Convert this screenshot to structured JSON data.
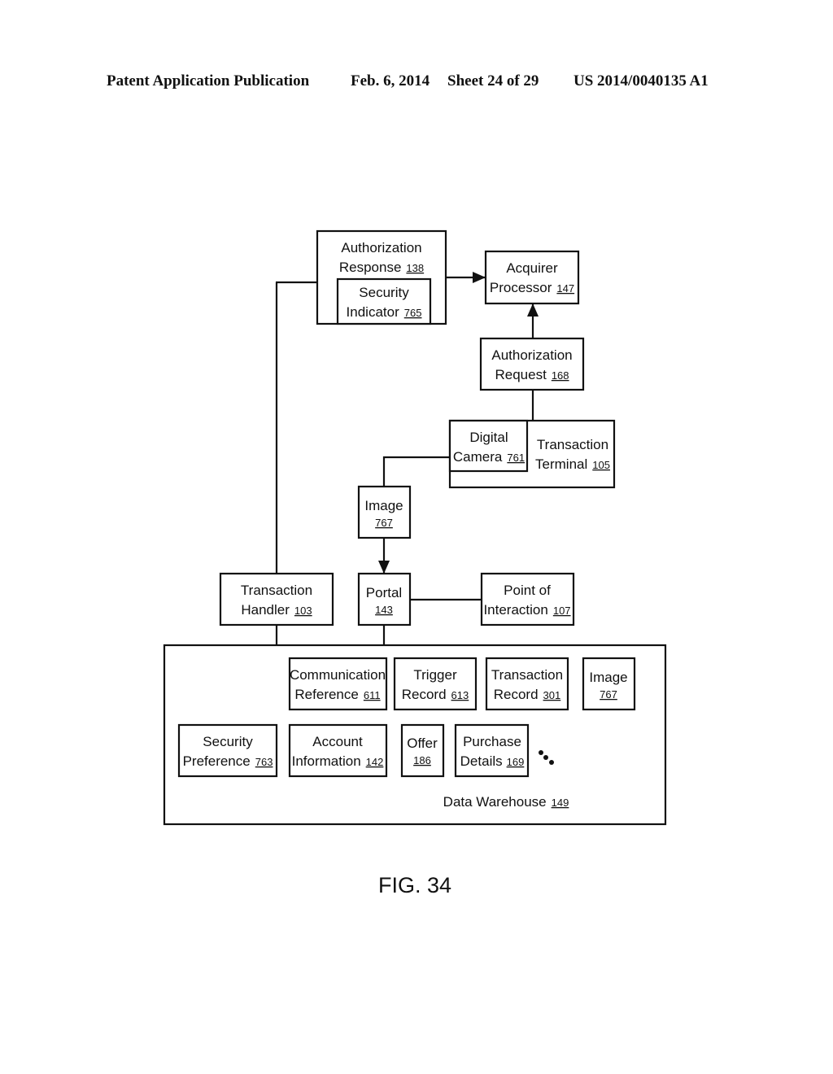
{
  "header": {
    "publication": "Patent Application Publication",
    "date": "Feb. 6, 2014",
    "sheet": "Sheet 24 of 29",
    "number": "US 2014/0040135 A1"
  },
  "figure_label": "FIG. 34",
  "nodes": {
    "auth_response": {
      "l1": "Authorization",
      "l2": "Response",
      "ref": "138"
    },
    "security_indicator": {
      "l1": "Security",
      "l2": "Indicator",
      "ref": "765"
    },
    "acquirer_processor": {
      "l1": "Acquirer",
      "l2": "Processor",
      "ref": "147"
    },
    "auth_request": {
      "l1": "Authorization",
      "l2": "Request",
      "ref": "168"
    },
    "digital_camera": {
      "l1": "Digital",
      "l2": "Camera",
      "ref": "761"
    },
    "transaction_terminal": {
      "l1": "Transaction",
      "l2": "Terminal",
      "ref": "105"
    },
    "image_top": {
      "l1": "Image",
      "ref": "767"
    },
    "transaction_handler": {
      "l1": "Transaction",
      "l2": "Handler",
      "ref": "103"
    },
    "portal": {
      "l1": "Portal",
      "ref": "143"
    },
    "point_of_interaction": {
      "l1": "Point of",
      "l2": "Interaction",
      "ref": "107"
    },
    "communication_reference": {
      "l1": "Communication",
      "l2": "Reference",
      "ref": "611"
    },
    "trigger_record": {
      "l1": "Trigger",
      "l2": "Record",
      "ref": "613"
    },
    "transaction_record": {
      "l1": "Transaction",
      "l2": "Record",
      "ref": "301"
    },
    "image_warehouse": {
      "l1": "Image",
      "ref": "767"
    },
    "security_preference": {
      "l1": "Security",
      "l2": "Preference",
      "ref": "763"
    },
    "account_information": {
      "l1": "Account",
      "l2": "Information",
      "ref": "142"
    },
    "offer": {
      "l1": "Offer",
      "ref": "186"
    },
    "purchase_details": {
      "l1": "Purchase",
      "l2": "Details",
      "ref": "169"
    },
    "data_warehouse": {
      "l1": "Data Warehouse",
      "ref": "149"
    }
  }
}
